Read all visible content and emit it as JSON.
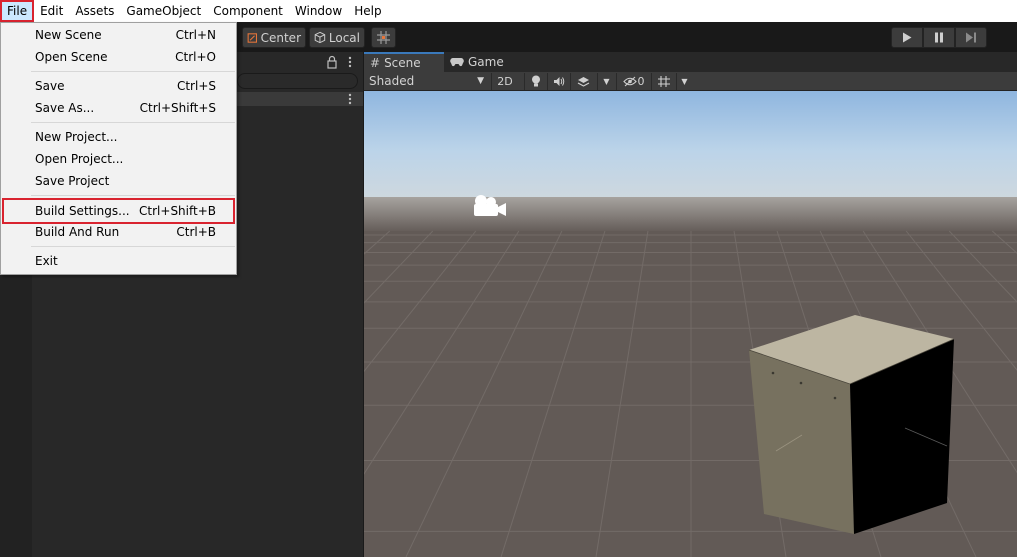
{
  "menubar": {
    "items": [
      "File",
      "Edit",
      "Assets",
      "GameObject",
      "Component",
      "Window",
      "Help"
    ]
  },
  "toolbar": {
    "center_label": "Center",
    "local_label": "Local",
    "icons": [
      "center-pivot-icon",
      "local-cube-icon",
      "grid-snap-icon",
      "play-icon",
      "pause-icon",
      "step-icon"
    ]
  },
  "scene_tabs": {
    "scene_label": "Scene",
    "game_label": "Game"
  },
  "scene_toolbar": {
    "shading_mode": "Shaded",
    "mode_2d": "2D",
    "hidden_count": "0"
  },
  "file_menu": {
    "items": [
      {
        "label": "New Scene",
        "shortcut": "Ctrl+N"
      },
      {
        "label": "Open Scene",
        "shortcut": "Ctrl+O"
      },
      {
        "label": "Save",
        "shortcut": "Ctrl+S"
      },
      {
        "label": "Save As...",
        "shortcut": "Ctrl+Shift+S"
      },
      {
        "label": "New Project...",
        "shortcut": ""
      },
      {
        "label": "Open Project...",
        "shortcut": ""
      },
      {
        "label": "Save Project",
        "shortcut": ""
      },
      {
        "label": "Build Settings...",
        "shortcut": "Ctrl+Shift+B"
      },
      {
        "label": "Build And Run",
        "shortcut": "Ctrl+B"
      },
      {
        "label": "Exit",
        "shortcut": ""
      }
    ]
  },
  "colors": {
    "highlight_box": "#d9232f",
    "menubar_bg": "#ffffff",
    "editor_dark": "#282828",
    "sky_top": "#8fb6df",
    "ground": "#625a56"
  }
}
